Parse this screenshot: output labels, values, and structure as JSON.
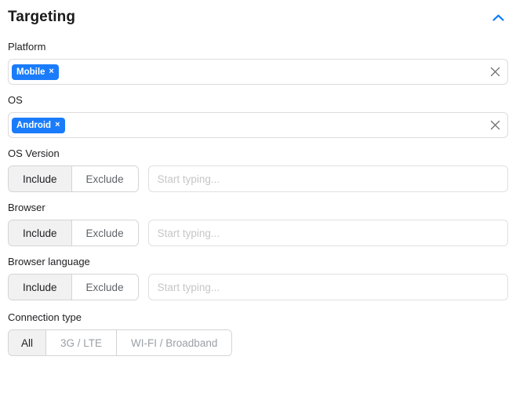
{
  "panel": {
    "title": "Targeting",
    "collapse_icon": "chevron-up-icon",
    "accent_color": "#0b7bfa"
  },
  "fields": {
    "platform": {
      "label": "Platform",
      "chips": [
        {
          "label": "Mobile",
          "remove_icon": "×"
        }
      ],
      "clear_icon": "×"
    },
    "os": {
      "label": "OS",
      "chips": [
        {
          "label": "Android",
          "remove_icon": "×"
        }
      ],
      "clear_icon": "×"
    },
    "os_version": {
      "label": "OS Version",
      "segments": [
        {
          "label": "Include",
          "selected": true
        },
        {
          "label": "Exclude",
          "selected": false
        }
      ],
      "input_value": "",
      "input_placeholder": "Start typing..."
    },
    "browser": {
      "label": "Browser",
      "segments": [
        {
          "label": "Include",
          "selected": true
        },
        {
          "label": "Exclude",
          "selected": false
        }
      ],
      "input_value": "",
      "input_placeholder": "Start typing..."
    },
    "browser_language": {
      "label": "Browser language",
      "segments": [
        {
          "label": "Include",
          "selected": true
        },
        {
          "label": "Exclude",
          "selected": false
        }
      ],
      "input_value": "",
      "input_placeholder": "Start typing..."
    },
    "connection_type": {
      "label": "Connection type",
      "segments": [
        {
          "label": "All",
          "selected": true
        },
        {
          "label": "3G / LTE",
          "selected": false
        },
        {
          "label": "WI-FI / Broadband",
          "selected": false
        }
      ]
    }
  }
}
